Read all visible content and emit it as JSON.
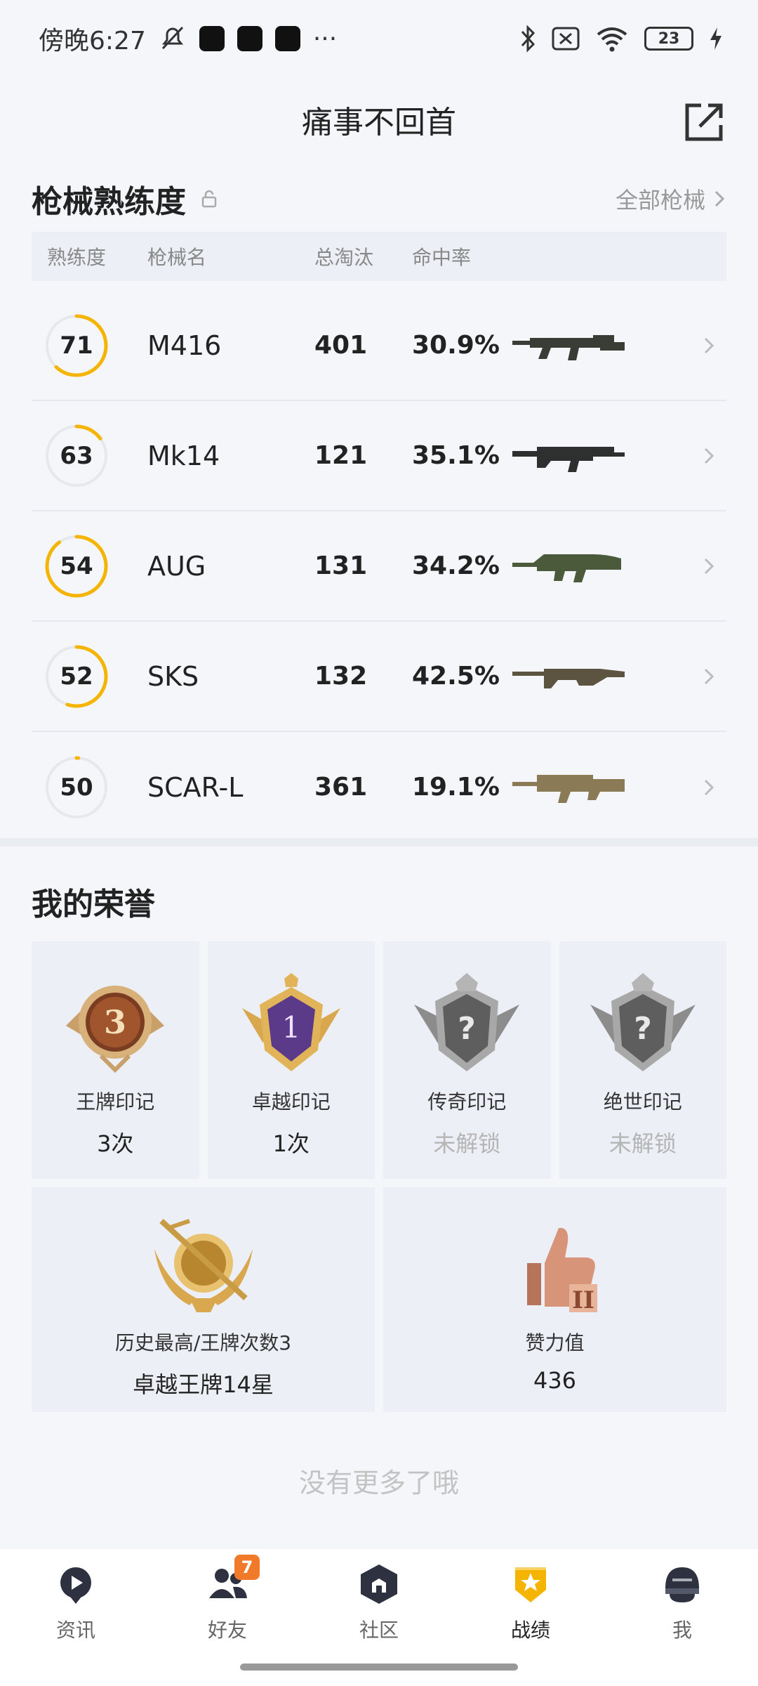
{
  "status_bar": {
    "time": "傍晚6:27",
    "battery": "23"
  },
  "header": {
    "title": "痛事不回首"
  },
  "weapons": {
    "title": "枪械熟练度",
    "all_link": "全部枪械",
    "columns": {
      "mastery": "熟练度",
      "name": "枪械名",
      "kills": "总淘汰",
      "accuracy": "命中率"
    },
    "items": [
      {
        "level": "71",
        "name": "M416",
        "kills": "401",
        "accuracy": "30.9%",
        "progress": 0.62,
        "gun_color": "#3a3d36"
      },
      {
        "level": "63",
        "name": "Mk14",
        "kills": "121",
        "accuracy": "35.1%",
        "progress": 0.15,
        "gun_color": "#2e2f2f"
      },
      {
        "level": "54",
        "name": "AUG",
        "kills": "131",
        "accuracy": "34.2%",
        "progress": 0.9,
        "gun_color": "#4a5a3a"
      },
      {
        "level": "52",
        "name": "SKS",
        "kills": "132",
        "accuracy": "42.5%",
        "progress": 0.55,
        "gun_color": "#5c5440"
      },
      {
        "level": "50",
        "name": "SCAR-L",
        "kills": "361",
        "accuracy": "19.1%",
        "progress": 0.01,
        "gun_color": "#8b7a56"
      }
    ],
    "ring_color": "#f5b400"
  },
  "honors": {
    "title": "我的荣誉",
    "marks": [
      {
        "label": "王牌印记",
        "value": "3次",
        "locked": false,
        "icon": "ace-mark-icon"
      },
      {
        "label": "卓越印记",
        "value": "1次",
        "locked": false,
        "icon": "excellence-mark-icon"
      },
      {
        "label": "传奇印记",
        "value": "未解锁",
        "locked": true,
        "icon": "legend-mark-icon"
      },
      {
        "label": "绝世印记",
        "value": "未解锁",
        "locked": true,
        "icon": "peerless-mark-icon"
      }
    ],
    "highest": {
      "label": "历史最高/王牌次数3",
      "value": "卓越王牌14星"
    },
    "effort": {
      "label": "赞力值",
      "value": "436"
    }
  },
  "footer_text": "没有更多了哦",
  "nav": {
    "items": [
      {
        "label": "资讯",
        "icon": "news-icon"
      },
      {
        "label": "好友",
        "icon": "friends-icon",
        "badge": "7"
      },
      {
        "label": "社区",
        "icon": "community-icon"
      },
      {
        "label": "战绩",
        "icon": "record-icon",
        "active": true
      },
      {
        "label": "我",
        "icon": "profile-icon"
      }
    ]
  }
}
